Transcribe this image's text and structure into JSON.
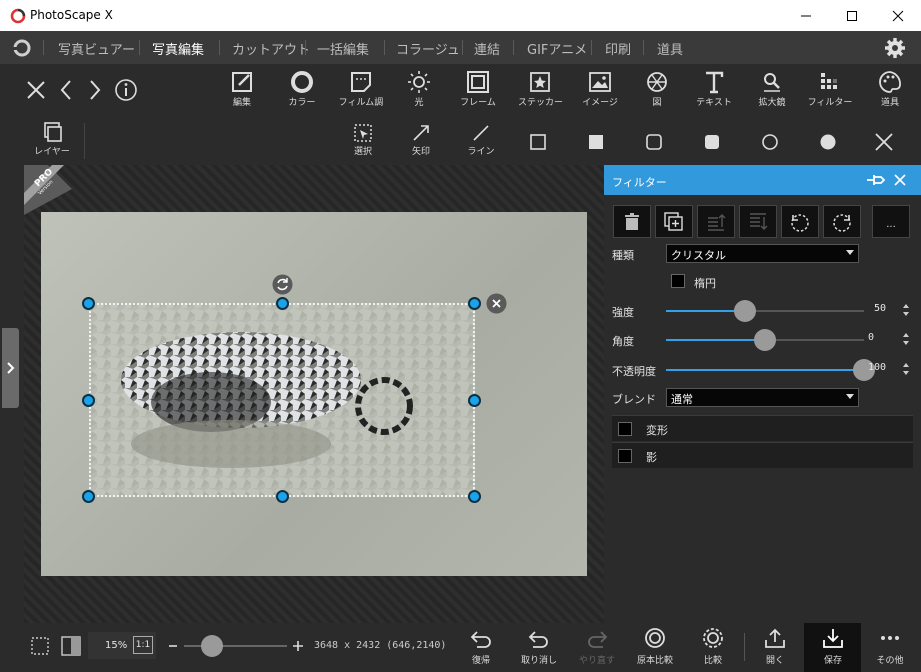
{
  "app": {
    "title": "PhotoScape X"
  },
  "window_controls": [
    "minimize-icon",
    "maximize-icon",
    "close-icon"
  ],
  "menu": [
    "写真ビュアー",
    "写真編集",
    "カットアウト",
    "一括編集",
    "コラージュ",
    "連結",
    "GIFアニメ",
    "印刷",
    "道具"
  ],
  "menu_active": "写真編集",
  "toolbar1": {
    "left_icons": [
      "close-icon",
      "chevron-left-icon",
      "chevron-right-icon",
      "info-icon"
    ],
    "tools": [
      "編集",
      "カラー",
      "フィルム調",
      "光",
      "フレーム"
    ],
    "tabs": [
      "ステッカー",
      "イメージ",
      "図",
      "テキスト",
      "拡大鏡",
      "フィルター"
    ],
    "tools_right": "道具"
  },
  "toolbar2": {
    "layer": "レイヤー",
    "tools": [
      "選択",
      "矢印",
      "ライン"
    ],
    "shapes": [
      "square-outline-icon",
      "square-filled-icon",
      "rounded-square-outline-icon",
      "rounded-square-filled-icon",
      "circle-outline-icon",
      "circle-filled-icon"
    ]
  },
  "badge": {
    "line1": "PRO",
    "line2": "Version"
  },
  "panel": {
    "title": "フィルター",
    "more": "...",
    "type_label": "種類",
    "type_value": "クリスタル",
    "ellipse_label": "楕円",
    "strength_label": "強度",
    "strength_value": "50",
    "strength_fraction": 0.4,
    "angle_label": "角度",
    "angle_value": "0",
    "angle_fraction": 0.5,
    "opacity_label": "不透明度",
    "opacity_value": "100",
    "opacity_fraction": 1.0,
    "blend_label": "ブレンド",
    "blend_value": "通常",
    "transform_label": "変形",
    "shadow_label": "影"
  },
  "bottombar": {
    "zoom": "15%",
    "one_to_one": "1:1",
    "zoom_fraction": 0.27,
    "image_info": "3648 x 2432 (646,2140)",
    "buttons": [
      "復帰",
      "取り消し",
      "やり直す",
      "原本比較",
      "比較",
      "開く",
      "保存",
      "その他"
    ]
  },
  "colors": {
    "accent": "#3399dd",
    "handle": "#1aa3e8"
  }
}
